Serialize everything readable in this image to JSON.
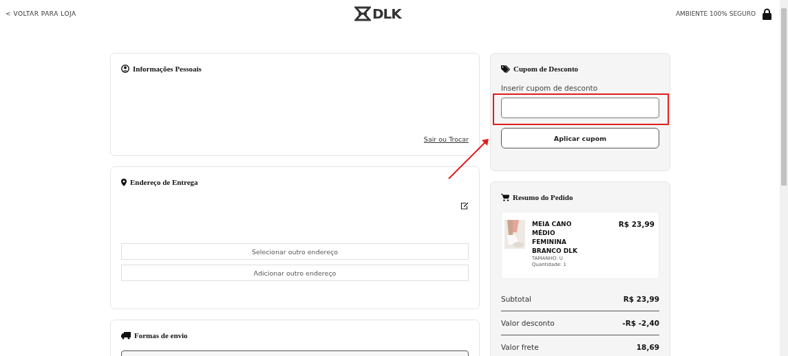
{
  "header": {
    "back_link": "< VOLTAR PARA LOJA",
    "logo": "DLK",
    "security_note": "AMBIENTE 100% SEGURO"
  },
  "personal_info": {
    "title": "Informações Pessoais",
    "link": "Sair ou Trocar"
  },
  "delivery_address": {
    "title": "Endereço de Entrega",
    "buttons": [
      "Selecionar outro endereço",
      "Adicionar outro endereço"
    ]
  },
  "shipping": {
    "title": "Formas de envio"
  },
  "coupon": {
    "title": "Cupom de Desconto",
    "label": "Inserir cupom de desconto",
    "button": "Aplicar cupom",
    "highlighted": true
  },
  "order_summary": {
    "title": "Resumo do Pedido",
    "items": [
      {
        "kind": "picture",
        "name": "MEIA CANO MÉDIO FEMININA BRANCO DLK",
        "size": "TAMANHO: U",
        "quantity": "Quantidade: 1",
        "price": "R$ 23,99"
      }
    ],
    "totals": [
      {
        "label": "Subtotal",
        "value": "R$ 23,99"
      },
      {
        "label": "Valor desconto",
        "value": "-R$ -2,40"
      },
      {
        "label": "Valor frete",
        "value": "18,69"
      }
    ]
  }
}
